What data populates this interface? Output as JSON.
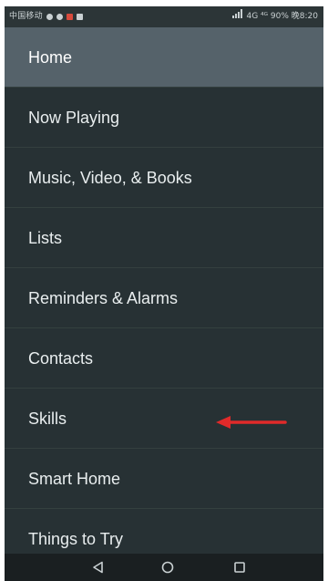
{
  "status_bar": {
    "carrier": "中国移动",
    "right_text": "4G ⁴ᴳ 90% 晚8:20"
  },
  "menu": {
    "items": [
      {
        "label": "Home",
        "selected": true
      },
      {
        "label": "Now Playing"
      },
      {
        "label": "Music, Video, & Books"
      },
      {
        "label": "Lists"
      },
      {
        "label": "Reminders & Alarms"
      },
      {
        "label": "Contacts"
      },
      {
        "label": "Skills"
      },
      {
        "label": "Smart Home"
      },
      {
        "label": "Things to Try"
      }
    ]
  },
  "annotation": {
    "arrow_color": "#e02a2a",
    "target": "Skills"
  },
  "nav_bar": {
    "back_icon": "back-triangle-icon",
    "home_icon": "home-circle-icon",
    "recents_icon": "recents-square-icon"
  },
  "colors": {
    "background": "#273134",
    "selected_item": "#55626a",
    "text": "#e9eeef"
  }
}
